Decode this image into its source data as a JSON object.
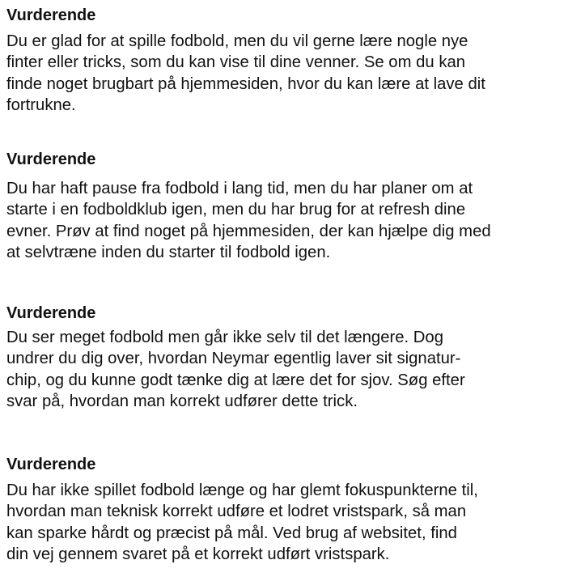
{
  "scenarios": [
    {
      "title": "Vurderende",
      "text": "Du er glad for at spille fodbold, men du vil gerne lære nogle nye\nfinter eller tricks, som du kan vise til dine venner. Se om du kan\nfinde noget brugbart på hjemmesiden, hvor du kan lære at lave dit\nfortrukne."
    },
    {
      "title": "Vurderende",
      "text": "Du har haft pause fra fodbold i lang tid, men du har planer om at\nstarte i en fodboldklub igen, men du har brug for at refresh dine\nevner. Prøv at find noget på hjemmesiden, der kan hjælpe dig med\nat selvtræne inden du starter til fodbold igen."
    },
    {
      "title": "Vurderende",
      "text": "Du ser meget fodbold men går ikke selv til det længere. Dog\nundrer du dig over, hvordan Neymar egentlig laver sit signatur-\nchip, og du kunne godt tænke dig at lære det for sjov. Søg efter\nsvar på, hvordan man korrekt udfører dette trick."
    },
    {
      "title": "Vurderende",
      "text": "Du har ikke spillet fodbold længe og har glemt fokuspunkterne til,\nhvordan man teknisk korrekt udføre et lodret vristspark, så man\nkan sparke hårdt og præcist på mål. Ved brug af websitet, find\ndin vej gennem svaret på et korrekt udført vristspark."
    }
  ]
}
